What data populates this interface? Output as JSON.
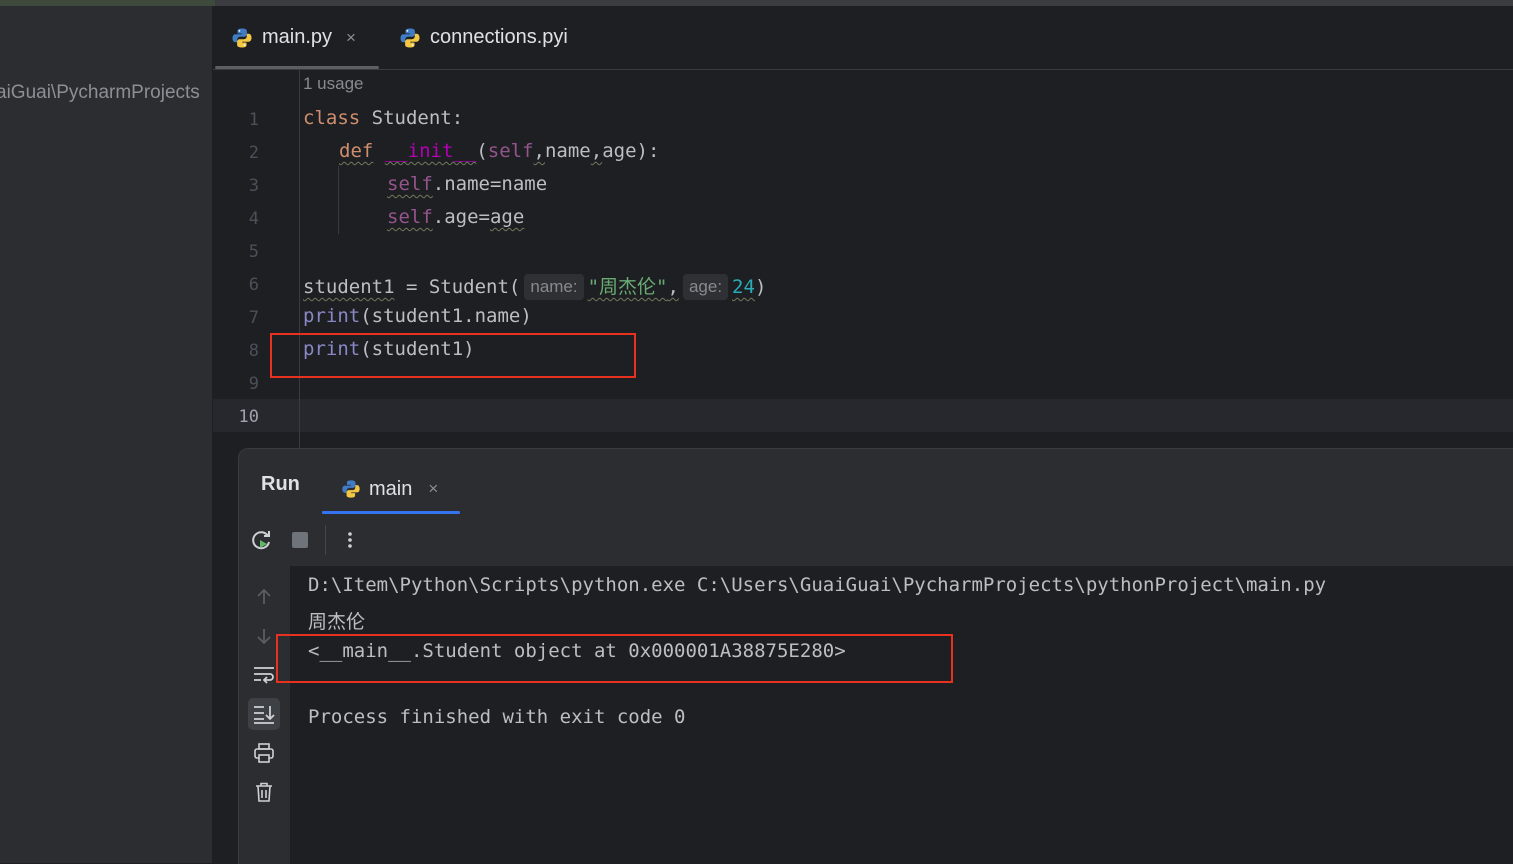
{
  "sidebar": {
    "path_text": "aiGuai\\PycharmProjects"
  },
  "editor": {
    "tabs": [
      {
        "label": "main.py",
        "close": "×",
        "icon": "python-icon",
        "active": true
      },
      {
        "label": "connections.pyi",
        "icon": "python-icon",
        "active": false
      }
    ],
    "usage_hint": "1 usage",
    "line_numbers": [
      "1",
      "2",
      "3",
      "4",
      "5",
      "6",
      "7",
      "8",
      "9",
      "10"
    ],
    "code": {
      "l1_kw": "class",
      "l1_rest": " Student:",
      "l2_kw": "def",
      "l2_fn": "__init__",
      "l2_paren": "(",
      "l2_self": "self",
      "l2_comma1": ",",
      "l2_name": "name",
      "l2_comma2": ",",
      "l2_age": "age",
      "l2_close": "):",
      "l3_self": "self",
      "l3_rest": ".name=name",
      "l4_self": "self",
      "l4_dot": ".age=",
      "l4_age": "age",
      "l6_var": "student1",
      "l6_mid": " = Student(",
      "l6_hint_name": "name:",
      "l6_str": "\"周杰伦\"",
      "l6_comma": ",",
      "l6_hint_age": "age:",
      "l6_num": "24",
      "l6_close": ")",
      "l7_builtin": "print",
      "l7_rest": "(student1.name)",
      "l8_builtin": "print",
      "l8_rest": "(student1)"
    }
  },
  "run_panel": {
    "title": "Run",
    "tab_label": "main",
    "tab_close": "×",
    "toolbar": [
      "rerun-icon",
      "stop-icon",
      "more-vertical-icon"
    ],
    "side_tools": [
      "arrow-up-icon",
      "arrow-down-icon",
      "soft-wrap-icon",
      "scroll-to-end-icon",
      "print-icon",
      "trash-icon"
    ],
    "output": [
      "D:\\Item\\Python\\Scripts\\python.exe C:\\Users\\GuaiGuai\\PycharmProjects\\pythonProject\\main.py",
      "周杰伦",
      "<__main__.Student object at 0x000001A38875E280>",
      "",
      "Process finished with exit code 0"
    ]
  },
  "colors": {
    "highlight_box": "#e8321f",
    "run_tab_accent": "#3574f0",
    "keyword": "#cf8e6d",
    "string": "#6aab73",
    "number": "#2aacb8"
  }
}
